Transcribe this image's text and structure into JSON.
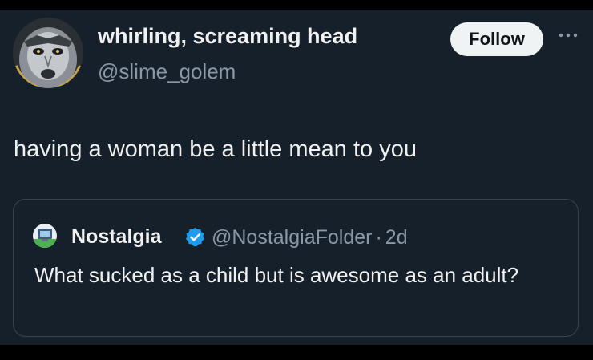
{
  "tweet": {
    "author": {
      "display_name": "whirling, screaming head",
      "handle": "@slime_golem",
      "avatar_icon": "screaming-face-avatar"
    },
    "follow_label": "Follow",
    "more_icon": "more-horizontal-icon",
    "text": "having a woman be a little mean to you"
  },
  "quoted_tweet": {
    "author": {
      "display_name": "Nostalgia",
      "handle": "@NostalgiaFolder",
      "avatar_icon": "retro-computer-avatar",
      "verified_icon": "verified-badge-icon"
    },
    "separator": "·",
    "age": "2d",
    "text": "What sucked as a child but is awesome as an adult?"
  },
  "colors": {
    "background": "#15202b",
    "text_primary": "#f1f1f1",
    "text_secondary": "#8b98a5",
    "follow_button": "#eff3f4",
    "verified": "#1d9bf0",
    "border": "#38444d"
  }
}
